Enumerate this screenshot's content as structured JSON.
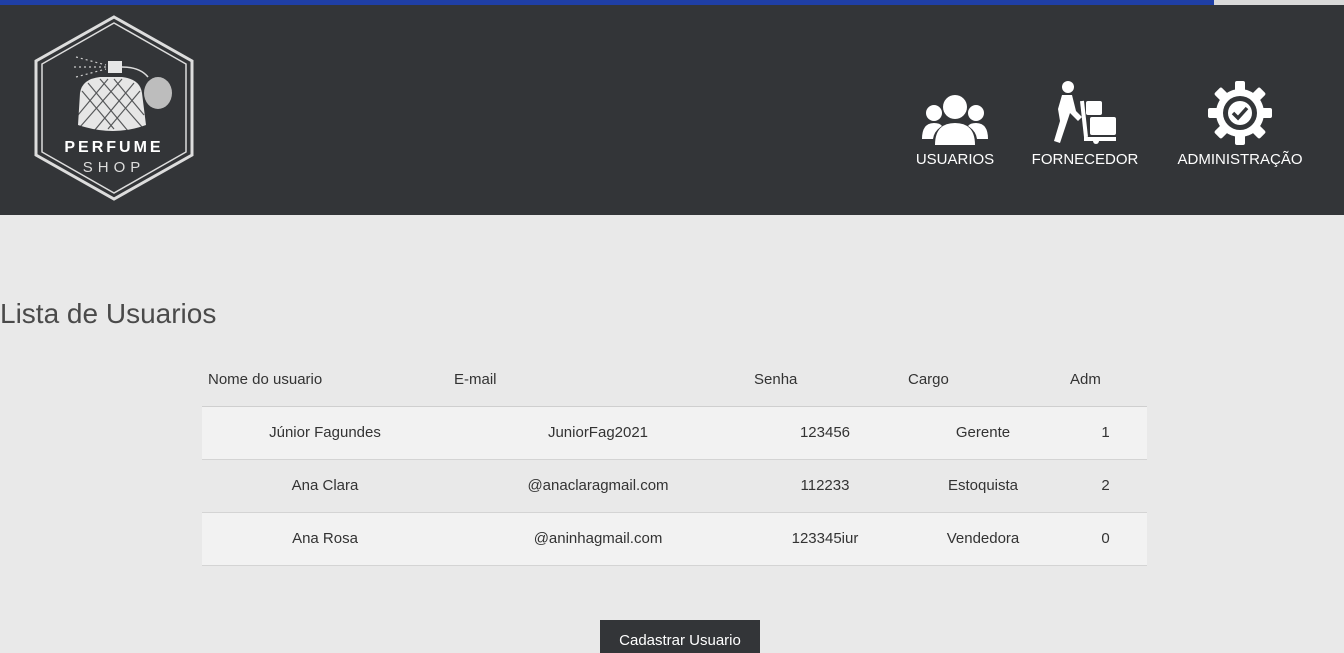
{
  "brand": {
    "line1": "PERFUME",
    "line2": "SHOP"
  },
  "colors": {
    "header_bg": "#333538",
    "page_bg": "#e9e9e9",
    "accent_line": "#1f3fa6"
  },
  "nav": {
    "items": [
      {
        "label": "USUARIOS",
        "icon": "users-icon"
      },
      {
        "label": "FORNECEDOR",
        "icon": "delivery-worker-icon"
      },
      {
        "label": "ADMINISTRAÇÃO",
        "icon": "gear-check-icon"
      }
    ]
  },
  "main": {
    "title": "Lista de Usuarios",
    "table": {
      "headers": [
        "Nome do usuario",
        "E-mail",
        "Senha",
        "Cargo",
        "Adm"
      ],
      "rows": [
        [
          "Júnior Fagundes",
          "JuniorFag2021",
          "123456",
          "Gerente",
          "1"
        ],
        [
          "Ana Clara",
          "@anaclaragmail.com",
          "112233",
          "Estoquista",
          "2"
        ],
        [
          "Ana Rosa",
          "@aninhagmail.com",
          "123345iur",
          "Vendedora",
          "0"
        ]
      ]
    },
    "cadastrar_label": "Cadastrar Usuario"
  }
}
